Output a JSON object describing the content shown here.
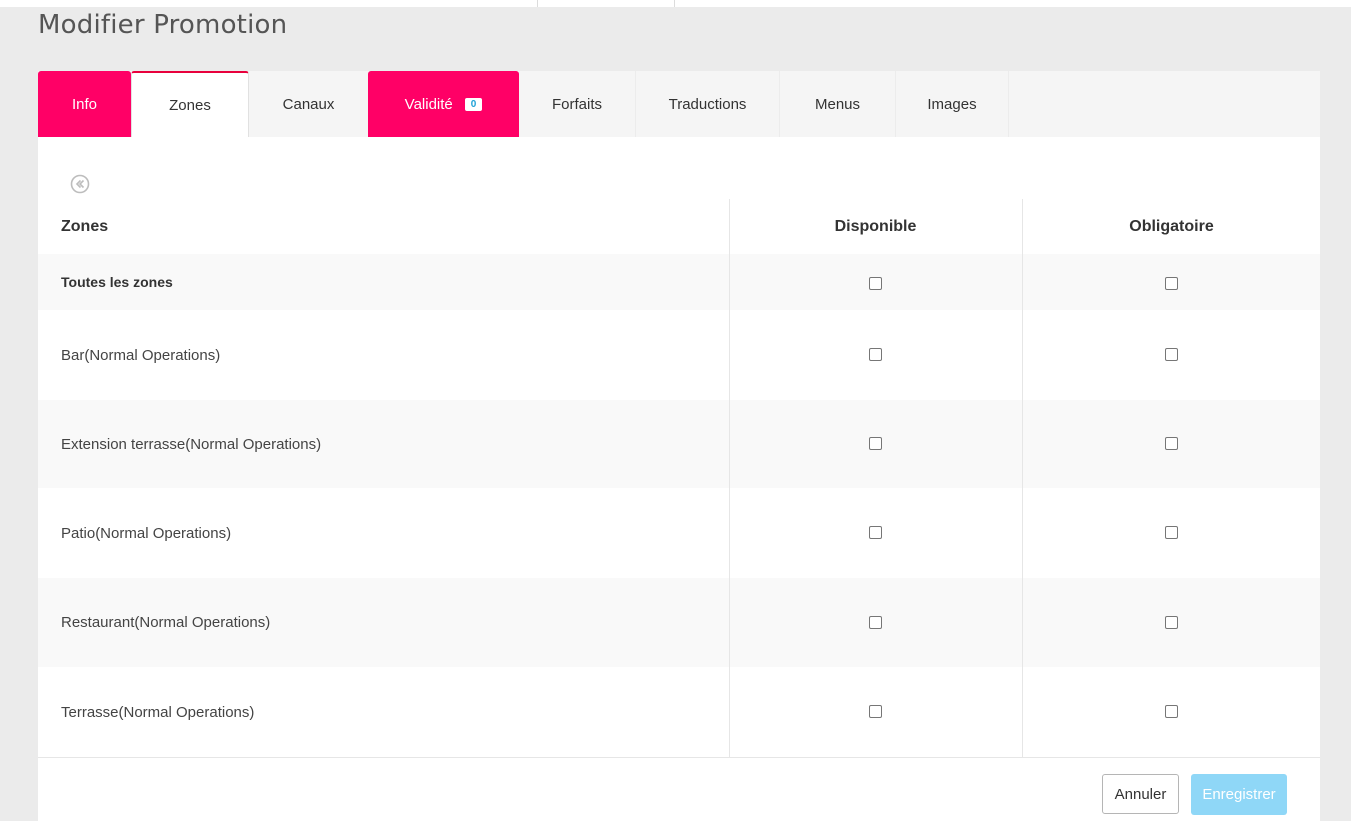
{
  "page": {
    "title": "Modifier Promotion"
  },
  "tabs": [
    {
      "label": "Info",
      "state": "error"
    },
    {
      "label": "Zones",
      "state": "active"
    },
    {
      "label": "Canaux",
      "state": "normal"
    },
    {
      "label": "Validité",
      "state": "error",
      "badge": "0"
    },
    {
      "label": "Forfaits",
      "state": "normal"
    },
    {
      "label": "Traductions",
      "state": "normal"
    },
    {
      "label": "Menus",
      "state": "normal"
    },
    {
      "label": "Images",
      "state": "normal"
    }
  ],
  "back": {
    "icon": "circle-chevron-left-icon"
  },
  "table": {
    "headers": {
      "zone": "Zones",
      "available": "Disponible",
      "mandatory": "Obligatoire"
    },
    "rows": [
      {
        "label": "Toutes les zones",
        "available": false,
        "mandatory": false
      },
      {
        "label": "Bar(Normal Operations)",
        "available": false,
        "mandatory": false
      },
      {
        "label": "Extension terrasse(Normal Operations)",
        "available": false,
        "mandatory": false
      },
      {
        "label": "Patio(Normal Operations)",
        "available": false,
        "mandatory": false
      },
      {
        "label": "Restaurant(Normal Operations)",
        "available": false,
        "mandatory": false
      },
      {
        "label": "Terrasse(Normal Operations)",
        "available": false,
        "mandatory": false
      }
    ]
  },
  "actions": {
    "cancel": "Annuler",
    "save": "Enregistrer"
  },
  "colors": {
    "error_tab": "#ff0066",
    "active_tab_border": "#e8003c",
    "save_button": "#8fd7f7",
    "badge_text": "#1da1d6"
  }
}
